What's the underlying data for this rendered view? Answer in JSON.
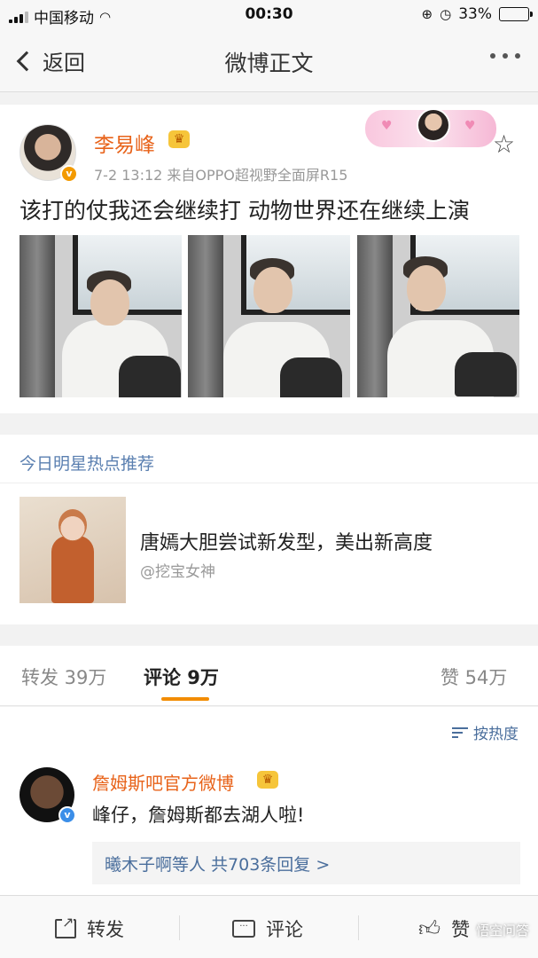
{
  "status_bar": {
    "carrier": "中国移动",
    "time": "00:30",
    "battery": "33%",
    "battery_level": 0.33
  },
  "nav": {
    "back_label": "返回",
    "title": "微博正文"
  },
  "post": {
    "author": "李易峰",
    "meta": "7-2 13:12  来自OPPO超视野全面屏R15",
    "text": "该打的仗我还会继续打 动物世界还在继续上演",
    "photo_count": 3
  },
  "recommend": {
    "section_title": "今日明星热点推荐",
    "headline": "唐嫣大胆尝试新发型，美出新高度",
    "source": "@挖宝女神"
  },
  "tabs": {
    "repost": "转发 39万",
    "comment": "评论 9万",
    "like": "赞 54万"
  },
  "comments": {
    "sort_label": "按热度",
    "items": [
      {
        "author": "詹姆斯吧官方微博",
        "text": "峰仔，詹姆斯都去湖人啦!",
        "replies": "曦木子啊等人  共703条回复 >"
      }
    ]
  },
  "bottom_bar": {
    "repost": "转发",
    "comment": "评论",
    "like": "赞"
  },
  "watermark": "悟空问答"
}
